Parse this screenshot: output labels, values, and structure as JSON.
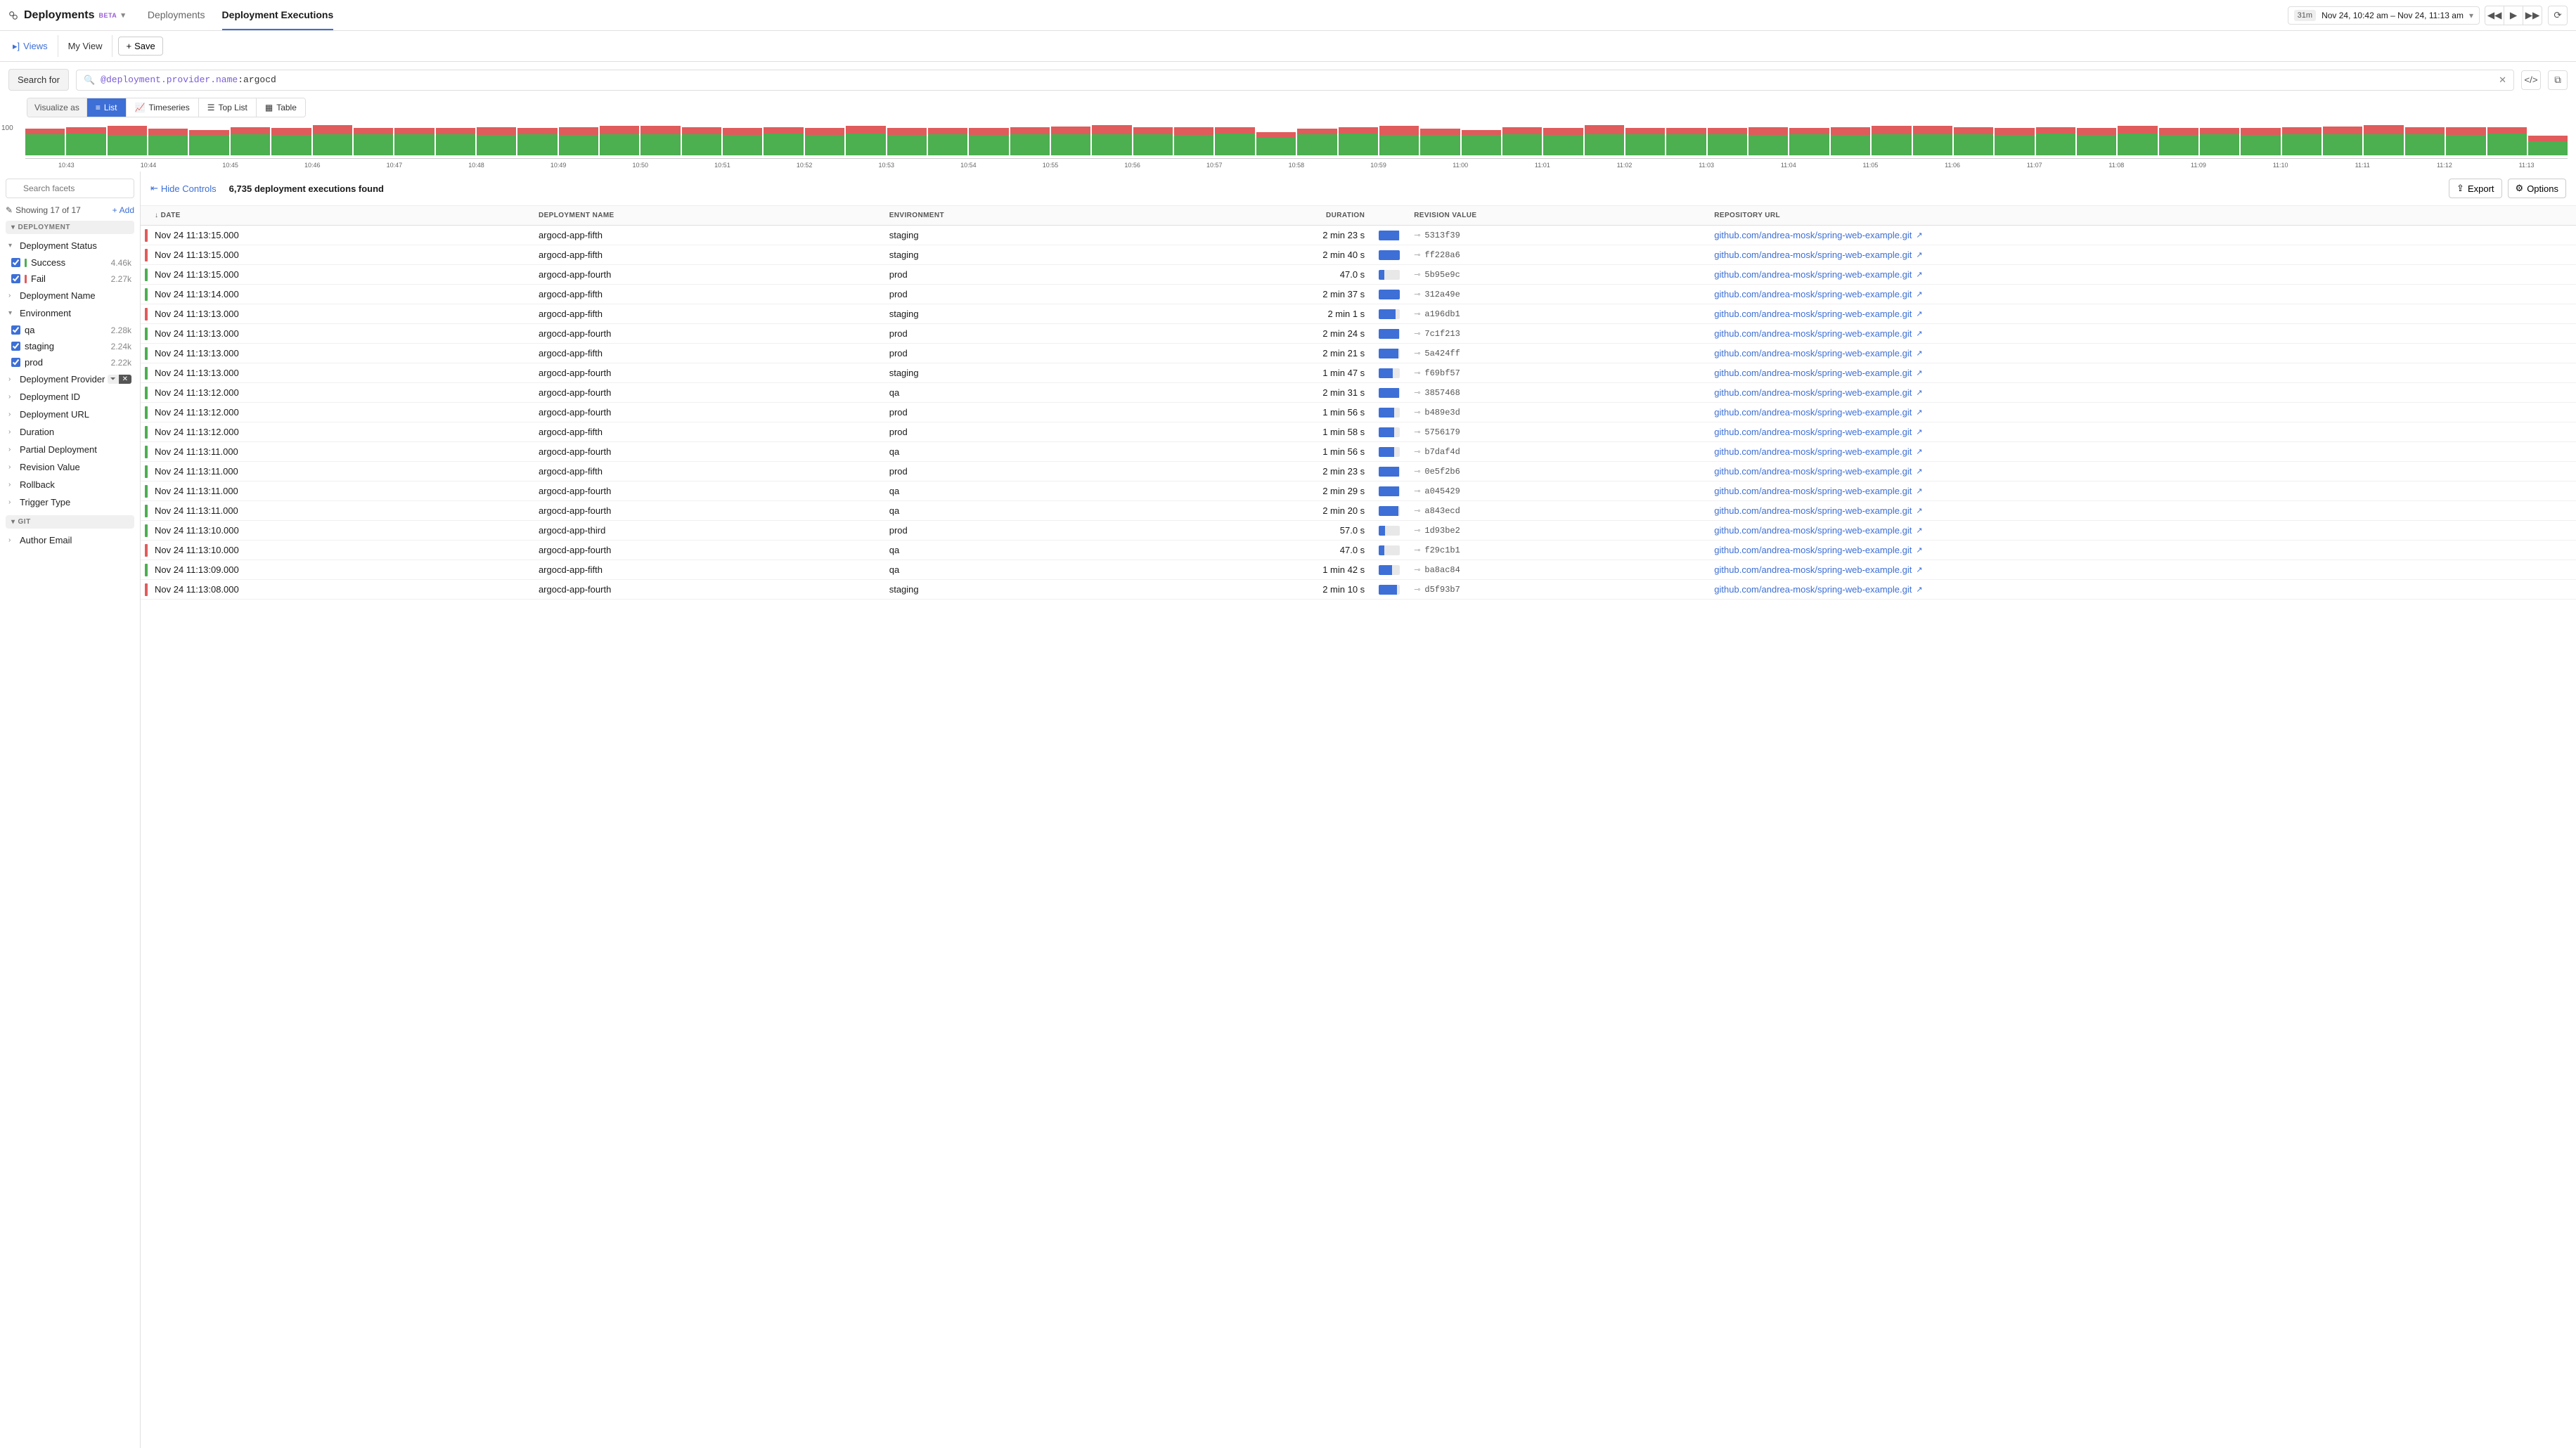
{
  "header": {
    "app_title": "Deployments",
    "beta": "BETA",
    "tabs": [
      {
        "label": "Deployments",
        "active": false
      },
      {
        "label": "Deployment Executions",
        "active": true
      }
    ],
    "time": {
      "duration": "31m",
      "range": "Nov 24, 10:42 am – Nov 24, 11:13 am"
    }
  },
  "secbar": {
    "views": "Views",
    "myview": "My View",
    "save": "Save"
  },
  "search": {
    "label": "Search for",
    "query_key": "@deployment.provider.name",
    "query_val": ":argocd",
    "viz_label": "Visualize as",
    "viz": [
      {
        "label": "List",
        "active": true
      },
      {
        "label": "Timeseries",
        "active": false
      },
      {
        "label": "Top List",
        "active": false
      },
      {
        "label": "Table",
        "active": false
      }
    ]
  },
  "chart_data": {
    "type": "bar",
    "ylabel": "",
    "ylim": [
      0,
      100
    ],
    "ymax_tick": "100",
    "categories": [
      "10:43",
      "10:44",
      "10:45",
      "10:46",
      "10:47",
      "10:48",
      "10:49",
      "10:50",
      "10:51",
      "10:52",
      "10:53",
      "10:54",
      "10:55",
      "10:56",
      "10:57",
      "10:58",
      "10:59",
      "11:00",
      "11:01",
      "11:02",
      "11:03",
      "11:04",
      "11:05",
      "11:06",
      "11:07",
      "11:08",
      "11:09",
      "11:10",
      "11:11",
      "11:12",
      "11:13"
    ],
    "series": [
      {
        "name": "Fail",
        "color": "#e05b5b"
      },
      {
        "name": "Success",
        "color": "#4caf50"
      }
    ],
    "bars": [
      {
        "red": 18,
        "green": 72
      },
      {
        "red": 22,
        "green": 74
      },
      {
        "red": 30,
        "green": 70
      },
      {
        "red": 20,
        "green": 70
      },
      {
        "red": 18,
        "green": 68
      },
      {
        "red": 24,
        "green": 72
      },
      {
        "red": 22,
        "green": 70
      },
      {
        "red": 30,
        "green": 72
      },
      {
        "red": 22,
        "green": 72
      },
      {
        "red": 22,
        "green": 72
      },
      {
        "red": 22,
        "green": 72
      },
      {
        "red": 26,
        "green": 70
      },
      {
        "red": 20,
        "green": 72
      },
      {
        "red": 26,
        "green": 70
      },
      {
        "red": 28,
        "green": 72
      },
      {
        "red": 28,
        "green": 72
      },
      {
        "red": 24,
        "green": 72
      },
      {
        "red": 22,
        "green": 70
      },
      {
        "red": 22,
        "green": 74
      },
      {
        "red": 22,
        "green": 70
      },
      {
        "red": 26,
        "green": 74
      },
      {
        "red": 24,
        "green": 70
      },
      {
        "red": 20,
        "green": 72
      },
      {
        "red": 24,
        "green": 70
      },
      {
        "red": 24,
        "green": 72
      },
      {
        "red": 26,
        "green": 72
      },
      {
        "red": 30,
        "green": 72
      },
      {
        "red": 24,
        "green": 72
      },
      {
        "red": 26,
        "green": 70
      },
      {
        "red": 22,
        "green": 74
      },
      {
        "red": 18,
        "green": 60
      },
      {
        "red": 18,
        "green": 72
      },
      {
        "red": 22,
        "green": 74
      },
      {
        "red": 30,
        "green": 70
      },
      {
        "red": 20,
        "green": 70
      },
      {
        "red": 18,
        "green": 68
      },
      {
        "red": 24,
        "green": 72
      },
      {
        "red": 22,
        "green": 70
      },
      {
        "red": 30,
        "green": 72
      },
      {
        "red": 22,
        "green": 72
      },
      {
        "red": 22,
        "green": 72
      },
      {
        "red": 22,
        "green": 72
      },
      {
        "red": 26,
        "green": 70
      },
      {
        "red": 20,
        "green": 72
      },
      {
        "red": 26,
        "green": 70
      },
      {
        "red": 28,
        "green": 72
      },
      {
        "red": 28,
        "green": 72
      },
      {
        "red": 24,
        "green": 72
      },
      {
        "red": 22,
        "green": 70
      },
      {
        "red": 22,
        "green": 74
      },
      {
        "red": 22,
        "green": 70
      },
      {
        "red": 26,
        "green": 74
      },
      {
        "red": 24,
        "green": 70
      },
      {
        "red": 20,
        "green": 72
      },
      {
        "red": 24,
        "green": 70
      },
      {
        "red": 24,
        "green": 72
      },
      {
        "red": 26,
        "green": 72
      },
      {
        "red": 30,
        "green": 72
      },
      {
        "red": 24,
        "green": 72
      },
      {
        "red": 26,
        "green": 70
      },
      {
        "red": 22,
        "green": 74
      },
      {
        "red": 18,
        "green": 48
      }
    ]
  },
  "sidebar": {
    "facet_search_placeholder": "Search facets",
    "showing": "Showing 17 of 17",
    "add": "Add",
    "groups": [
      {
        "name": "DEPLOYMENT"
      },
      {
        "name": "GIT"
      }
    ],
    "deployment_status": {
      "label": "Deployment Status",
      "options": [
        {
          "label": "Success",
          "count": "4.46k",
          "status": "ok"
        },
        {
          "label": "Fail",
          "count": "2.27k",
          "status": "fail"
        }
      ]
    },
    "environment": {
      "label": "Environment",
      "options": [
        {
          "label": "qa",
          "count": "2.28k"
        },
        {
          "label": "staging",
          "count": "2.24k"
        },
        {
          "label": "prod",
          "count": "2.22k"
        }
      ]
    },
    "collapsed": [
      "Deployment Name",
      "Deployment Provider",
      "Deployment ID",
      "Deployment URL",
      "Duration",
      "Partial Deployment",
      "Revision Value",
      "Rollback",
      "Trigger Type",
      "Author Email"
    ]
  },
  "content": {
    "hide_controls": "Hide Controls",
    "result_count": "6,735 deployment executions found",
    "export": "Export",
    "options": "Options",
    "columns": [
      "DATE",
      "DEPLOYMENT NAME",
      "ENVIRONMENT",
      "DURATION",
      "REVISION VALUE",
      "REPOSITORY URL"
    ],
    "repo": "github.com/andrea-mosk/spring-web-example.git",
    "rows": [
      {
        "status": "fail",
        "date": "Nov 24 11:13:15.000",
        "name": "argocd-app-fifth",
        "env": "staging",
        "dur": "2 min 23 s",
        "pct": 95,
        "rev": "5313f39"
      },
      {
        "status": "fail",
        "date": "Nov 24 11:13:15.000",
        "name": "argocd-app-fifth",
        "env": "staging",
        "dur": "2 min 40 s",
        "pct": 100,
        "rev": "ff228a6"
      },
      {
        "status": "ok",
        "date": "Nov 24 11:13:15.000",
        "name": "argocd-app-fourth",
        "env": "prod",
        "dur": "47.0 s",
        "pct": 25,
        "rev": "5b95e9c"
      },
      {
        "status": "ok",
        "date": "Nov 24 11:13:14.000",
        "name": "argocd-app-fifth",
        "env": "prod",
        "dur": "2 min 37 s",
        "pct": 98,
        "rev": "312a49e"
      },
      {
        "status": "fail",
        "date": "Nov 24 11:13:13.000",
        "name": "argocd-app-fifth",
        "env": "staging",
        "dur": "2 min 1 s",
        "pct": 80,
        "rev": "a196db1"
      },
      {
        "status": "ok",
        "date": "Nov 24 11:13:13.000",
        "name": "argocd-app-fourth",
        "env": "prod",
        "dur": "2 min 24 s",
        "pct": 95,
        "rev": "7c1f213"
      },
      {
        "status": "ok",
        "date": "Nov 24 11:13:13.000",
        "name": "argocd-app-fifth",
        "env": "prod",
        "dur": "2 min 21 s",
        "pct": 93,
        "rev": "5a424ff"
      },
      {
        "status": "ok",
        "date": "Nov 24 11:13:13.000",
        "name": "argocd-app-fourth",
        "env": "staging",
        "dur": "1 min 47 s",
        "pct": 65,
        "rev": "f69bf57"
      },
      {
        "status": "ok",
        "date": "Nov 24 11:13:12.000",
        "name": "argocd-app-fourth",
        "env": "qa",
        "dur": "2 min 31 s",
        "pct": 97,
        "rev": "3857468"
      },
      {
        "status": "ok",
        "date": "Nov 24 11:13:12.000",
        "name": "argocd-app-fourth",
        "env": "prod",
        "dur": "1 min 56 s",
        "pct": 72,
        "rev": "b489e3d"
      },
      {
        "status": "ok",
        "date": "Nov 24 11:13:12.000",
        "name": "argocd-app-fifth",
        "env": "prod",
        "dur": "1 min 58 s",
        "pct": 73,
        "rev": "5756179"
      },
      {
        "status": "ok",
        "date": "Nov 24 11:13:11.000",
        "name": "argocd-app-fourth",
        "env": "qa",
        "dur": "1 min 56 s",
        "pct": 72,
        "rev": "b7daf4d"
      },
      {
        "status": "ok",
        "date": "Nov 24 11:13:11.000",
        "name": "argocd-app-fifth",
        "env": "prod",
        "dur": "2 min 23 s",
        "pct": 95,
        "rev": "0e5f2b6"
      },
      {
        "status": "ok",
        "date": "Nov 24 11:13:11.000",
        "name": "argocd-app-fourth",
        "env": "qa",
        "dur": "2 min 29 s",
        "pct": 96,
        "rev": "a045429"
      },
      {
        "status": "ok",
        "date": "Nov 24 11:13:11.000",
        "name": "argocd-app-fourth",
        "env": "qa",
        "dur": "2 min 20 s",
        "pct": 92,
        "rev": "a843ecd"
      },
      {
        "status": "ok",
        "date": "Nov 24 11:13:10.000",
        "name": "argocd-app-third",
        "env": "prod",
        "dur": "57.0 s",
        "pct": 30,
        "rev": "1d93be2"
      },
      {
        "status": "fail",
        "date": "Nov 24 11:13:10.000",
        "name": "argocd-app-fourth",
        "env": "qa",
        "dur": "47.0 s",
        "pct": 25,
        "rev": "f29c1b1"
      },
      {
        "status": "ok",
        "date": "Nov 24 11:13:09.000",
        "name": "argocd-app-fifth",
        "env": "qa",
        "dur": "1 min 42 s",
        "pct": 62,
        "rev": "ba8ac84"
      },
      {
        "status": "fail",
        "date": "Nov 24 11:13:08.000",
        "name": "argocd-app-fourth",
        "env": "staging",
        "dur": "2 min 10 s",
        "pct": 86,
        "rev": "d5f93b7"
      }
    ]
  }
}
